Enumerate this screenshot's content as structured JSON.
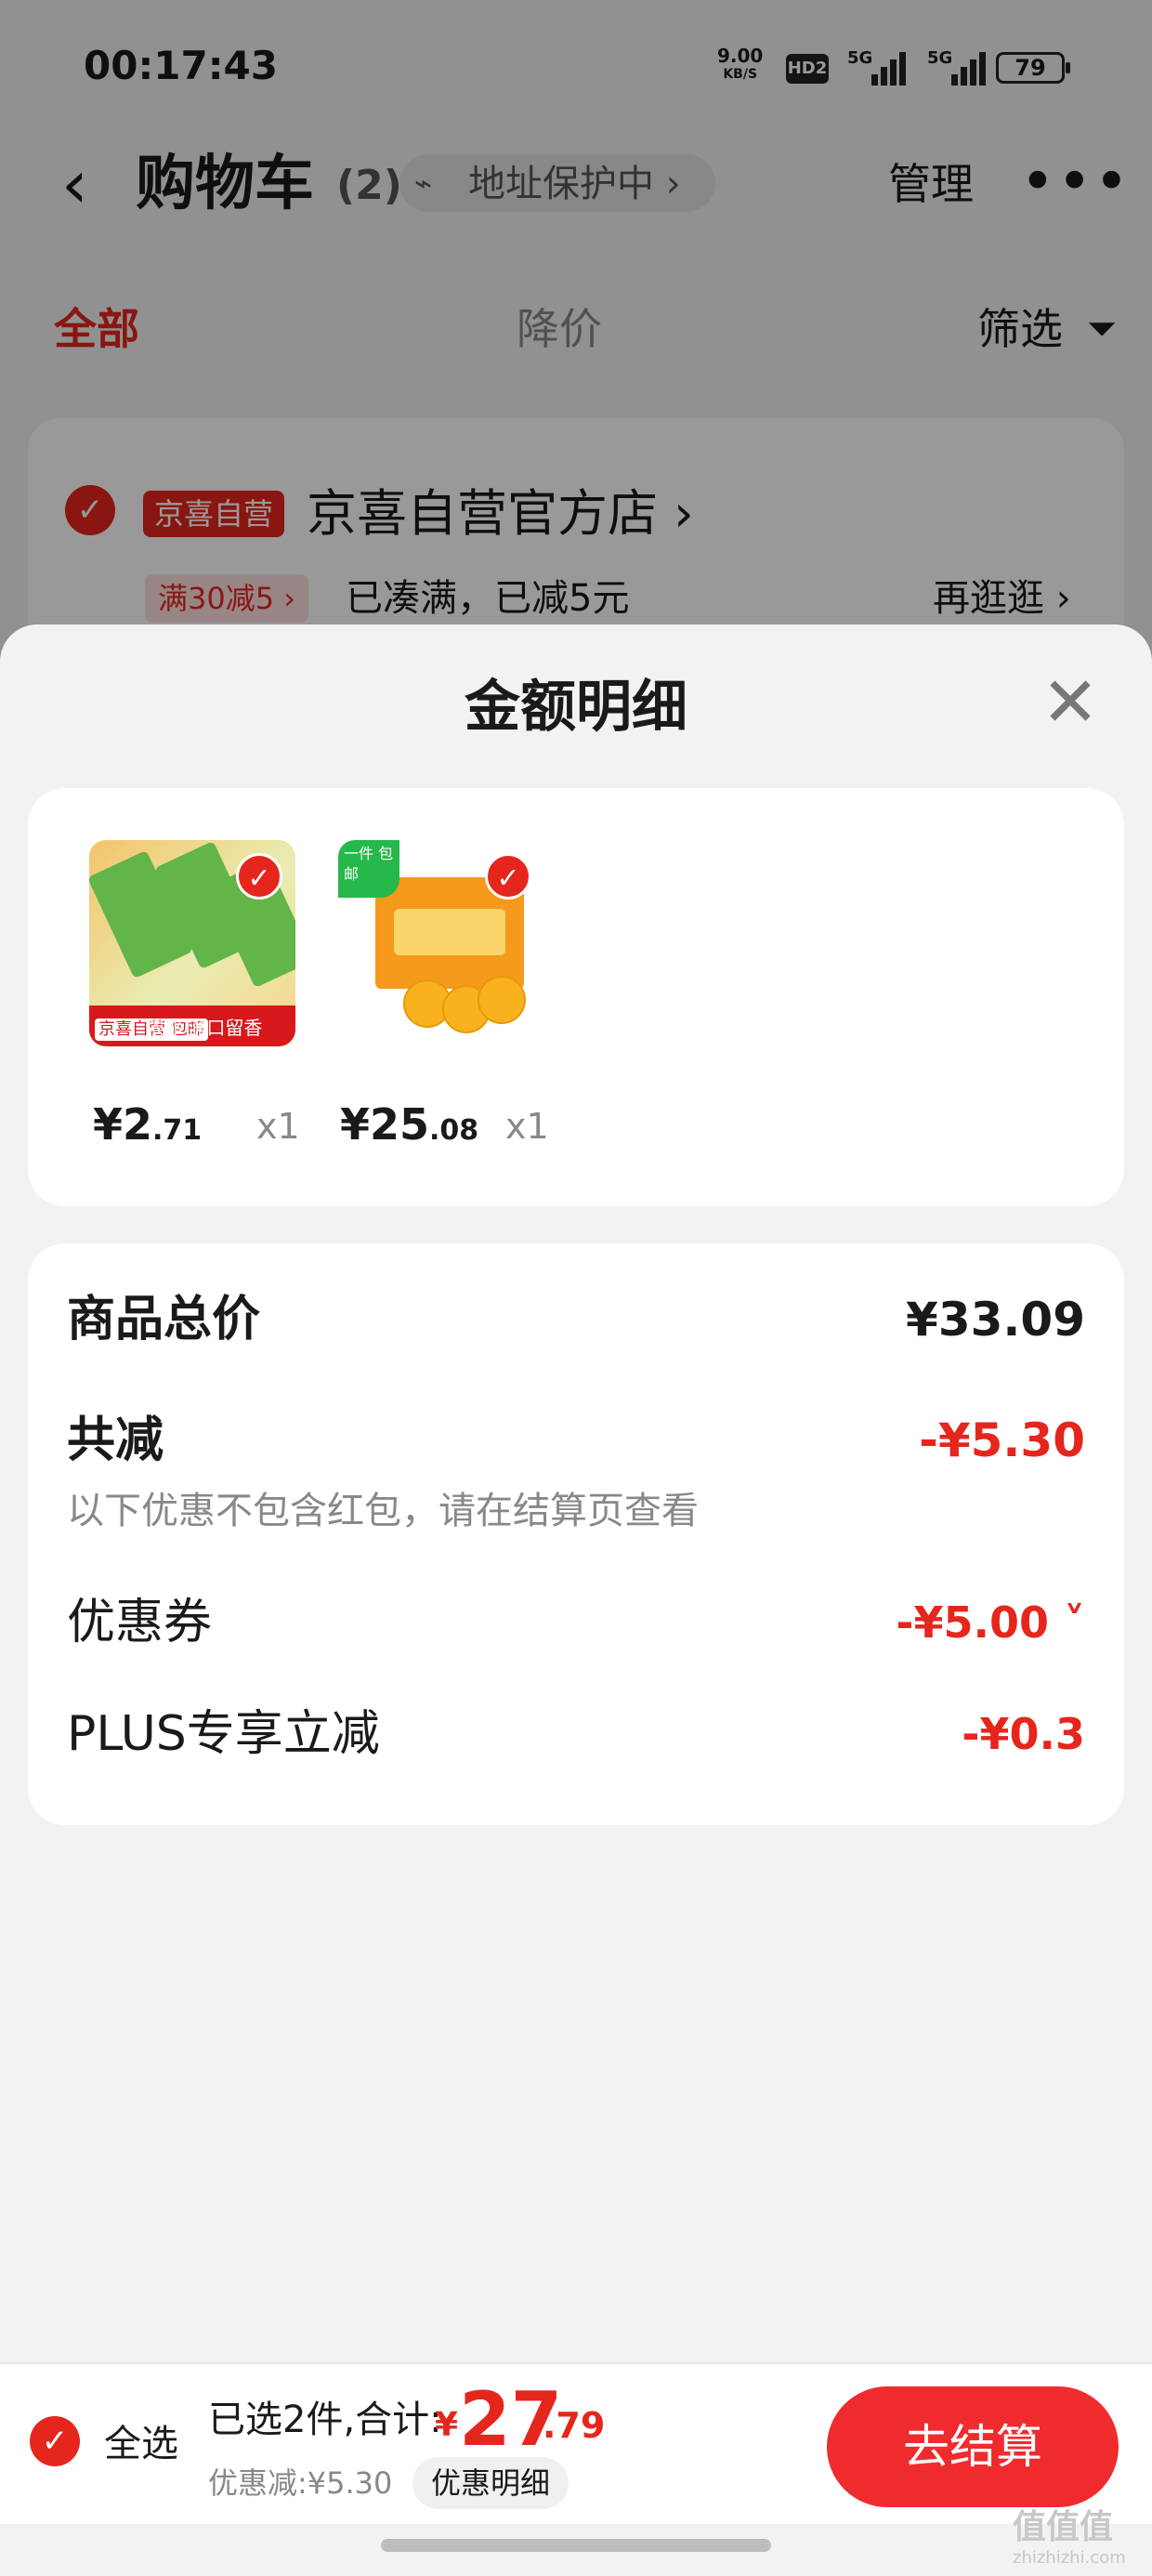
{
  "status_bar": {
    "time": "00:17:43",
    "net_speed": "9.00",
    "net_unit": "KB/S",
    "hd_label": "HD2",
    "signal1_label": "5G",
    "signal2_label": "5G",
    "battery": "79"
  },
  "header": {
    "back_icon": "‹",
    "title": "购物车",
    "count": "(2)",
    "address_protect": "地址保护中 ›",
    "manage_label": "管理",
    "more_icon": "•••"
  },
  "tabs": [
    {
      "label": "全部"
    },
    {
      "label": "降价"
    },
    {
      "label": "筛选"
    }
  ],
  "store": {
    "badge": "京喜自营",
    "name": "京喜自营官方店 ›",
    "promo_tag": "满30减5 ›",
    "promo_text": "已凑满，已减5元",
    "promo_more": "再逛逛 ›"
  },
  "modal": {
    "title": "金额明细",
    "items": [
      {
        "price_int": "¥2",
        "price_dec": ".71",
        "qty": "x1",
        "thumb_tag_left": "京喜自营 包邮",
        "thumb_tag_right": "浓郁 满口留香"
      },
      {
        "price_int": "¥25",
        "price_dec": ".08",
        "qty": "x1",
        "thumb_tag": "一件 包邮"
      }
    ],
    "summary": {
      "total_label": "商品总价",
      "total_value": "¥33.09",
      "reduce_label": "共减",
      "reduce_value": "-¥5.30",
      "reduce_note": "以下优惠不包含红包，请在结算页查看",
      "coupon_label": "优惠券",
      "coupon_value": "-¥5.00 ˅",
      "plus_label": "PLUS专享立减",
      "plus_value": "-¥0.3"
    }
  },
  "bottom_bar": {
    "select_all_label": "全选",
    "selected_summary": "已选2件,合计:",
    "total_symbol": "¥",
    "total_int": "27",
    "total_dec": ".79",
    "discount_line": "优惠减:¥5.30",
    "detail_label": "优惠明细",
    "checkout_label": "去结算"
  },
  "watermark": {
    "text": "值值值",
    "sub": "zhizhizhi.com"
  },
  "colors": {
    "accent": "#e5261d",
    "checkout": "#f02b2e",
    "background": "#f2f2f2"
  }
}
